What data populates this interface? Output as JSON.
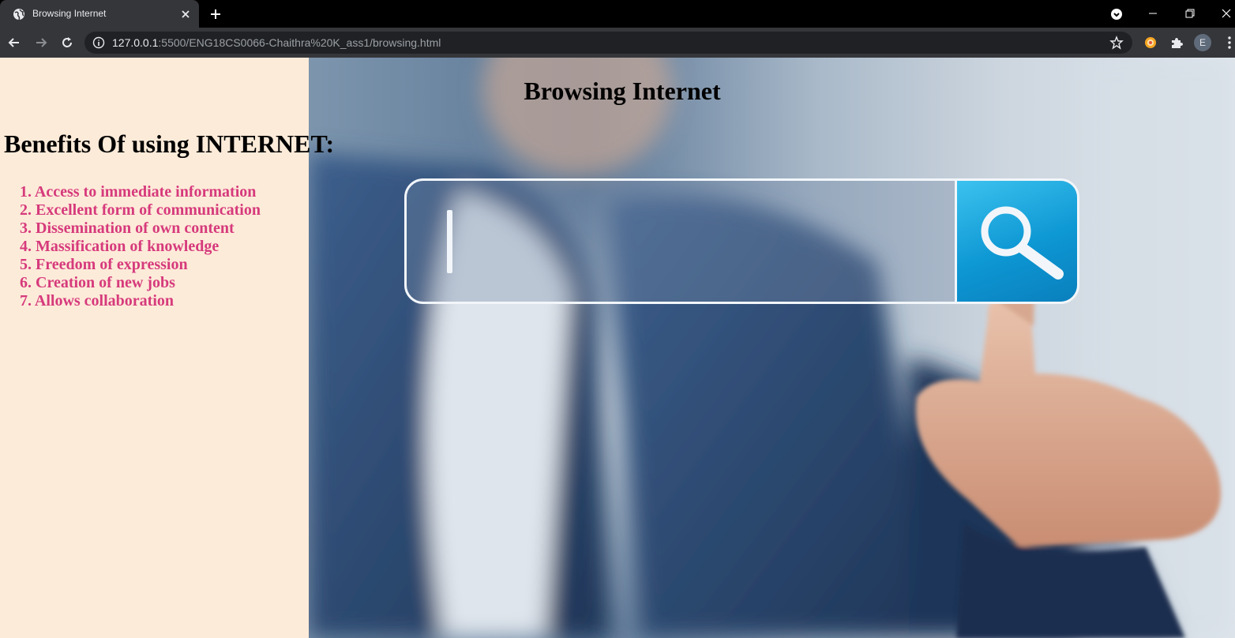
{
  "browser": {
    "tab_title": "Browsing Internet",
    "url_host": "127.0.0.1",
    "url_rest": ":5500/ENG18CS0066-Chaithra%20K_ass1/browsing.html",
    "profile_initial": "E"
  },
  "page": {
    "title": "Browsing Internet",
    "benefits_heading": "Benefits Of using INTERNET:",
    "benefits": [
      "1. Access to immediate information",
      "2. Excellent form of communication",
      "3. Dissemination of own content",
      "4. Massification of knowledge",
      "5. Freedom of expression",
      "6. Creation of new jobs",
      "7. Allows collaboration"
    ]
  },
  "colors": {
    "sidebar_bg": "#fdebd9",
    "list_text": "#d63a7c",
    "search_accent": "#0d97d3"
  },
  "icons": [
    "globe-icon",
    "close-icon",
    "plus-icon",
    "back-arrow-icon",
    "forward-arrow-icon",
    "reload-icon",
    "info-icon",
    "star-icon",
    "extension-icon",
    "puzzle-icon",
    "search-icon"
  ]
}
